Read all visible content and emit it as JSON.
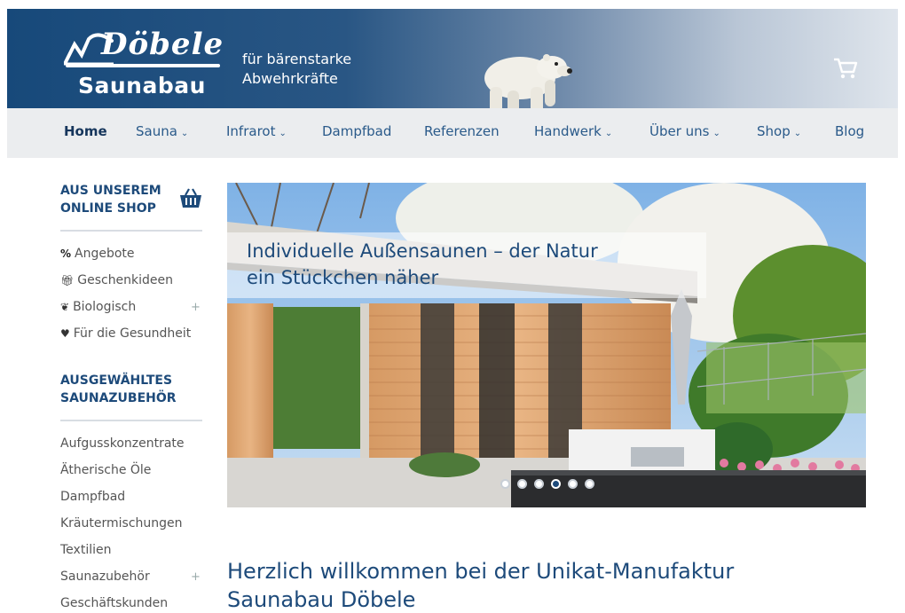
{
  "header": {
    "logo_script": "Döbele",
    "logo_name": "Saunabau",
    "tagline_line1": "für bärenstarke",
    "tagline_line2": "Abwehrkräfte"
  },
  "nav": {
    "items": [
      {
        "label": "Home",
        "dropdown": false,
        "active": true
      },
      {
        "label": "Sauna",
        "dropdown": true
      },
      {
        "label": "Infrarot",
        "dropdown": true
      },
      {
        "label": "Dampfbad",
        "dropdown": false
      },
      {
        "label": "Referenzen",
        "dropdown": false
      },
      {
        "label": "Handwerk",
        "dropdown": true
      },
      {
        "label": "Über uns",
        "dropdown": true
      },
      {
        "label": "Shop",
        "dropdown": true
      },
      {
        "label": "Blog",
        "dropdown": false
      }
    ]
  },
  "sidebar": {
    "shop_heading_line1": "AUS UNSEREM",
    "shop_heading_line2": "ONLINE SHOP",
    "shop_links": [
      {
        "icon": "%",
        "label": "Angebote"
      },
      {
        "icon": "gift",
        "label": "Geschenkideen"
      },
      {
        "icon": "leaf",
        "label": "Biologisch",
        "expandable": true
      },
      {
        "icon": "heart",
        "label": "Für die Gesundheit"
      }
    ],
    "accessory_heading_line1": "AUSGEWÄHLTES",
    "accessory_heading_line2": "SAUNAZUBEHÖR",
    "accessory_links": [
      {
        "label": "Aufgusskonzentrate"
      },
      {
        "label": "Ätherische Öle"
      },
      {
        "label": "Dampfbad"
      },
      {
        "label": "Kräutermischungen"
      },
      {
        "label": "Textilien"
      },
      {
        "label": "Saunazubehör",
        "expandable": true
      },
      {
        "label": "Geschäftskunden"
      }
    ]
  },
  "hero": {
    "caption_line1": "Individuelle Außensaunen – der Natur",
    "caption_line2": "ein Stückchen näher",
    "slide_count": 6,
    "active_slide": 4
  },
  "welcome": {
    "line1": "Herzlich willkommen bei der Unikat-Manufaktur",
    "line2": "Saunabau Döbele"
  },
  "colors": {
    "brand_blue": "#1d4a7a",
    "nav_text": "#2a5a8a",
    "nav_bg": "#ebedef"
  }
}
